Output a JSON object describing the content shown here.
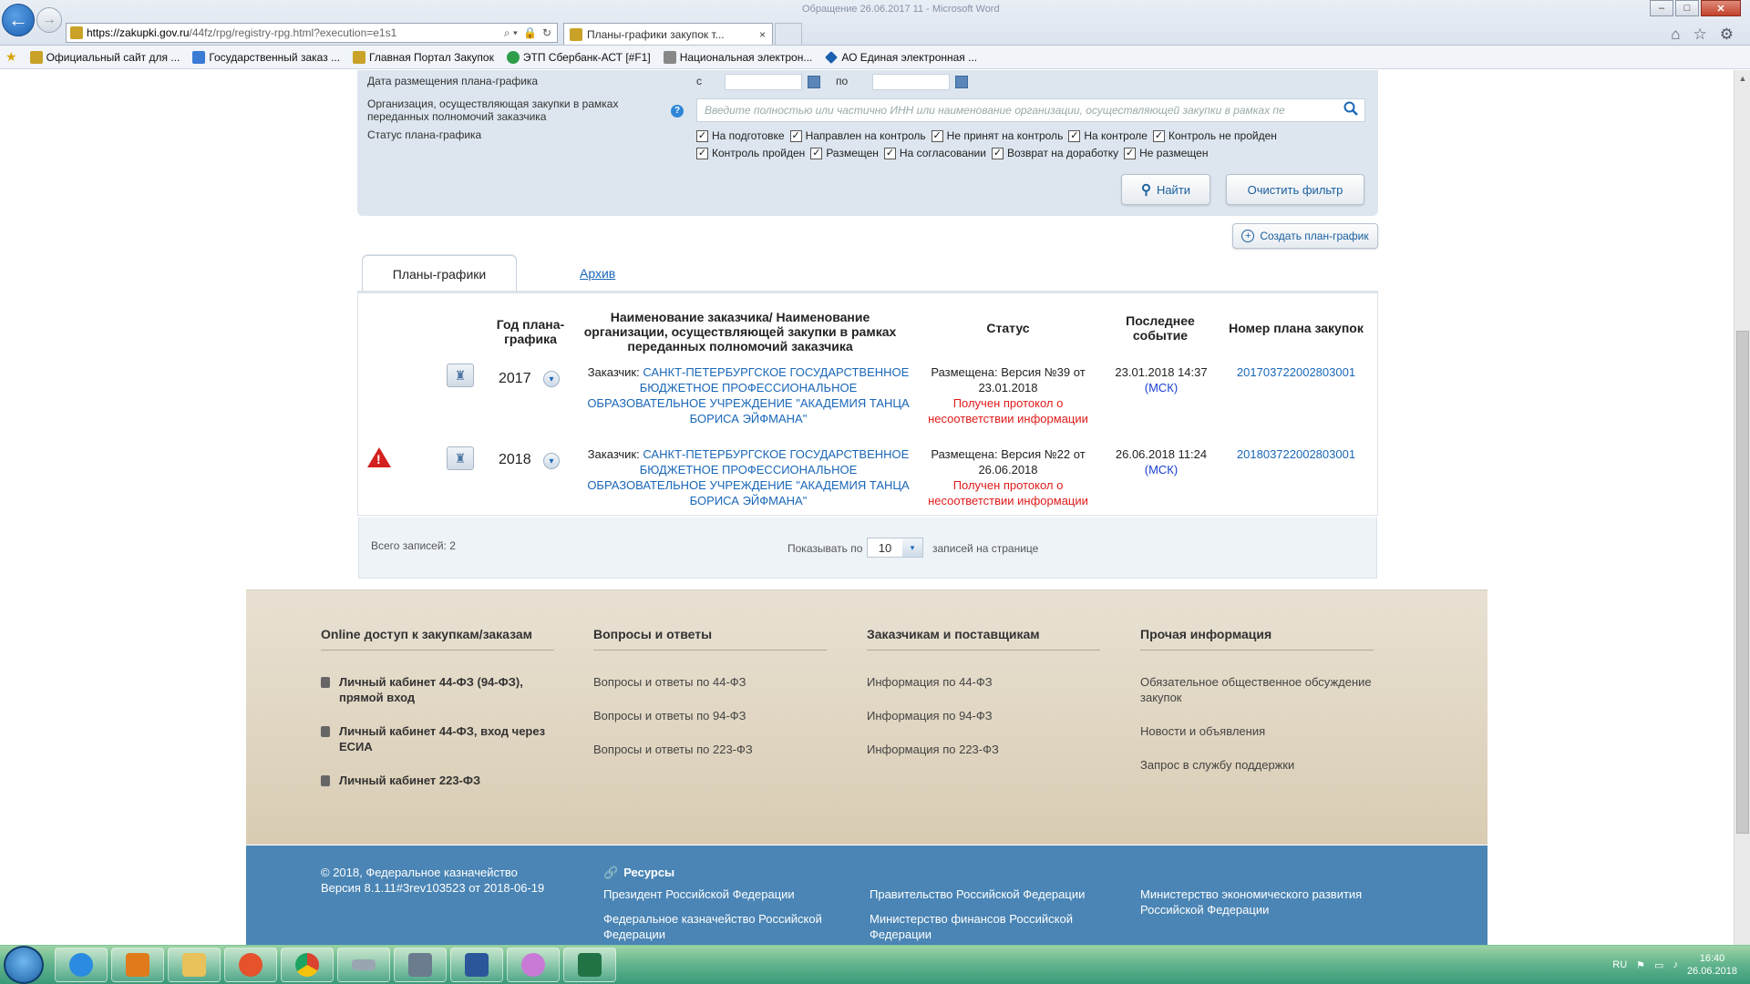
{
  "browser": {
    "url_host": "https://zakupki.gov.ru",
    "url_path": "/44fz/rpg/registry-rpg.html?execution=e1s1",
    "tab_title": "Планы-графики закупок т...",
    "tab_close": "×",
    "window_title": "Обращение 26.06.2017 11 - Microsoft Word",
    "back_glyph": "←",
    "forward_glyph": "→",
    "addr_tools": [
      "⌕ ▾",
      "🔒",
      "↻"
    ],
    "window_controls": {
      "minimize": "–",
      "maximize": "□",
      "close": "✕"
    },
    "right_tools": [
      "⌂",
      "☆",
      "⚙"
    ],
    "favorites_star": "★",
    "favorites": [
      {
        "label": "Официальный сайт для ...",
        "color": "#c9a227"
      },
      {
        "label": "Государственный заказ ...",
        "color": "#3a7bd5"
      },
      {
        "label": "Главная Портал Закупок",
        "color": "#c9a227"
      },
      {
        "label": "ЭТП Сбербанк-АСТ [#F1]",
        "color": "#2f9e4a"
      },
      {
        "label": "Национальная электрон...",
        "color": "#888888"
      },
      {
        "label": "АО Единая электронная ...",
        "color": "#1a5fb0"
      }
    ]
  },
  "filter": {
    "date_label": "Дата размещения плана-графика",
    "date_from": "с",
    "date_to": "по",
    "org_label": "Организация, осуществляющая закупки в рамках переданных полномочий заказчика",
    "help": "?",
    "org_placeholder": "Введите полностью или частично ИНН или наименование организации, осуществляющей закупки в рамках пе",
    "status_label": "Статус плана-графика",
    "checkbox_mark": "✓",
    "statuses_row1": [
      "На подготовке",
      "Направлен на контроль",
      "Не принят на контроль",
      "На контроле",
      "Контроль не пройден"
    ],
    "statuses_row2": [
      "Контроль пройден",
      "Размещен",
      "На согласовании",
      "Возврат на доработку",
      "Не размещен"
    ],
    "find_icon": "⚲",
    "find_label": "Найти",
    "clear_label": "Очистить фильтр",
    "create_icon": "+",
    "create_label": "Создать план-график"
  },
  "tabs": {
    "plans": "Планы-графики",
    "archive": "Архив"
  },
  "table": {
    "headers": {
      "year": "Год плана-графика",
      "name": "Наименование заказчика/ Наименование организации, осуществляющей закупки в рамках переданных полномочий заказчика",
      "status": "Статус",
      "event": "Последнее событие",
      "number": "Номер плана закупок"
    },
    "doc_icon": "♜",
    "dropdown_icon": "▾",
    "warning_icon": "!",
    "rows": [
      {
        "warning": false,
        "year": "2017",
        "customer_prefix": "Заказчик:",
        "customer": "САНКТ-ПЕТЕРБУРГСКОЕ ГОСУДАРСТВЕННОЕ БЮДЖЕТНОЕ ПРОФЕССИОНАЛЬНОЕ ОБРАЗОВАТЕЛЬНОЕ УЧРЕЖДЕНИЕ \"АКАДЕМИЯ ТАНЦА БОРИСА ЭЙФМАНА\"",
        "status": "Размещена: Версия №39 от 23.01.2018",
        "status_note": "Получен протокол о несоответствии информации",
        "event": "23.01.2018 14:37",
        "tz": "(МСК)",
        "number": "201703722002803001"
      },
      {
        "warning": true,
        "year": "2018",
        "customer_prefix": "Заказчик:",
        "customer": "САНКТ-ПЕТЕРБУРГСКОЕ ГОСУДАРСТВЕННОЕ БЮДЖЕТНОЕ ПРОФЕССИОНАЛЬНОЕ ОБРАЗОВАТЕЛЬНОЕ УЧРЕЖДЕНИЕ \"АКАДЕМИЯ ТАНЦА БОРИСА ЭЙФМАНА\"",
        "status": "Размещена: Версия №22 от 26.06.2018",
        "status_note": "Получен протокол о несоответствии информации",
        "event": "26.06.2018 11:24",
        "tz": "(МСК)",
        "number": "201803722002803001"
      }
    ],
    "total": "Всего записей: 2",
    "show_by": "Показывать по",
    "per_page": "10",
    "per_page_arrow": "▾",
    "per_page_suffix": "записей на странице"
  },
  "footer": {
    "col1": {
      "title": "Online доступ к закупкам/заказам",
      "links": [
        "Личный кабинет 44-ФЗ (94-ФЗ), прямой вход",
        "Личный кабинет 44-ФЗ, вход через ЕСИА",
        "Личный кабинет 223-ФЗ"
      ]
    },
    "col2": {
      "title": "Вопросы и ответы",
      "links": [
        "Вопросы и ответы по 44-ФЗ",
        "Вопросы и ответы по 94-ФЗ",
        "Вопросы и ответы по 223-ФЗ"
      ]
    },
    "col3": {
      "title": "Заказчикам и поставщикам",
      "links": [
        "Информация по 44-ФЗ",
        "Информация по 94-ФЗ",
        "Информация по 223-ФЗ"
      ]
    },
    "col4": {
      "title": "Прочая информация",
      "links": [
        "Обязательное общественное обсуждение закупок",
        "Новости и объявления",
        "Запрос в службу поддержки"
      ]
    },
    "copyright": "© 2018, Федеральное казначейство",
    "version": "Версия 8.1.11#3rev103523 от 2018-06-19",
    "resources_icon": "🔗",
    "resources_title": "Ресурсы",
    "resources": [
      "Президент Российской Федерации",
      "Правительство Российской Федерации",
      "Министерство экономического развития Российской Федерации",
      "Федеральное казначейство Российской Федерации",
      "Министерство финансов Российской Федерации"
    ]
  },
  "taskbar": {
    "apps": [
      {
        "name": "ie",
        "color": "#2a8be0"
      },
      {
        "name": "media-player",
        "color": "#e07a1a"
      },
      {
        "name": "explorer",
        "color": "#e8c25a"
      },
      {
        "name": "firefox",
        "color": "#e5522b"
      },
      {
        "name": "chrome",
        "color": "#d9432f"
      },
      {
        "name": "scanner",
        "color": "#9aa5b2"
      },
      {
        "name": "app-person",
        "color": "#6b7c8f"
      },
      {
        "name": "word",
        "color": "#2b579a"
      },
      {
        "name": "paint",
        "color": "#c97ad6"
      },
      {
        "name": "excel",
        "color": "#217346"
      }
    ],
    "lang": "RU",
    "tray_icons": [
      "⚑",
      "▭",
      "♪"
    ],
    "time": "16:40",
    "date": "26.06.2018"
  }
}
